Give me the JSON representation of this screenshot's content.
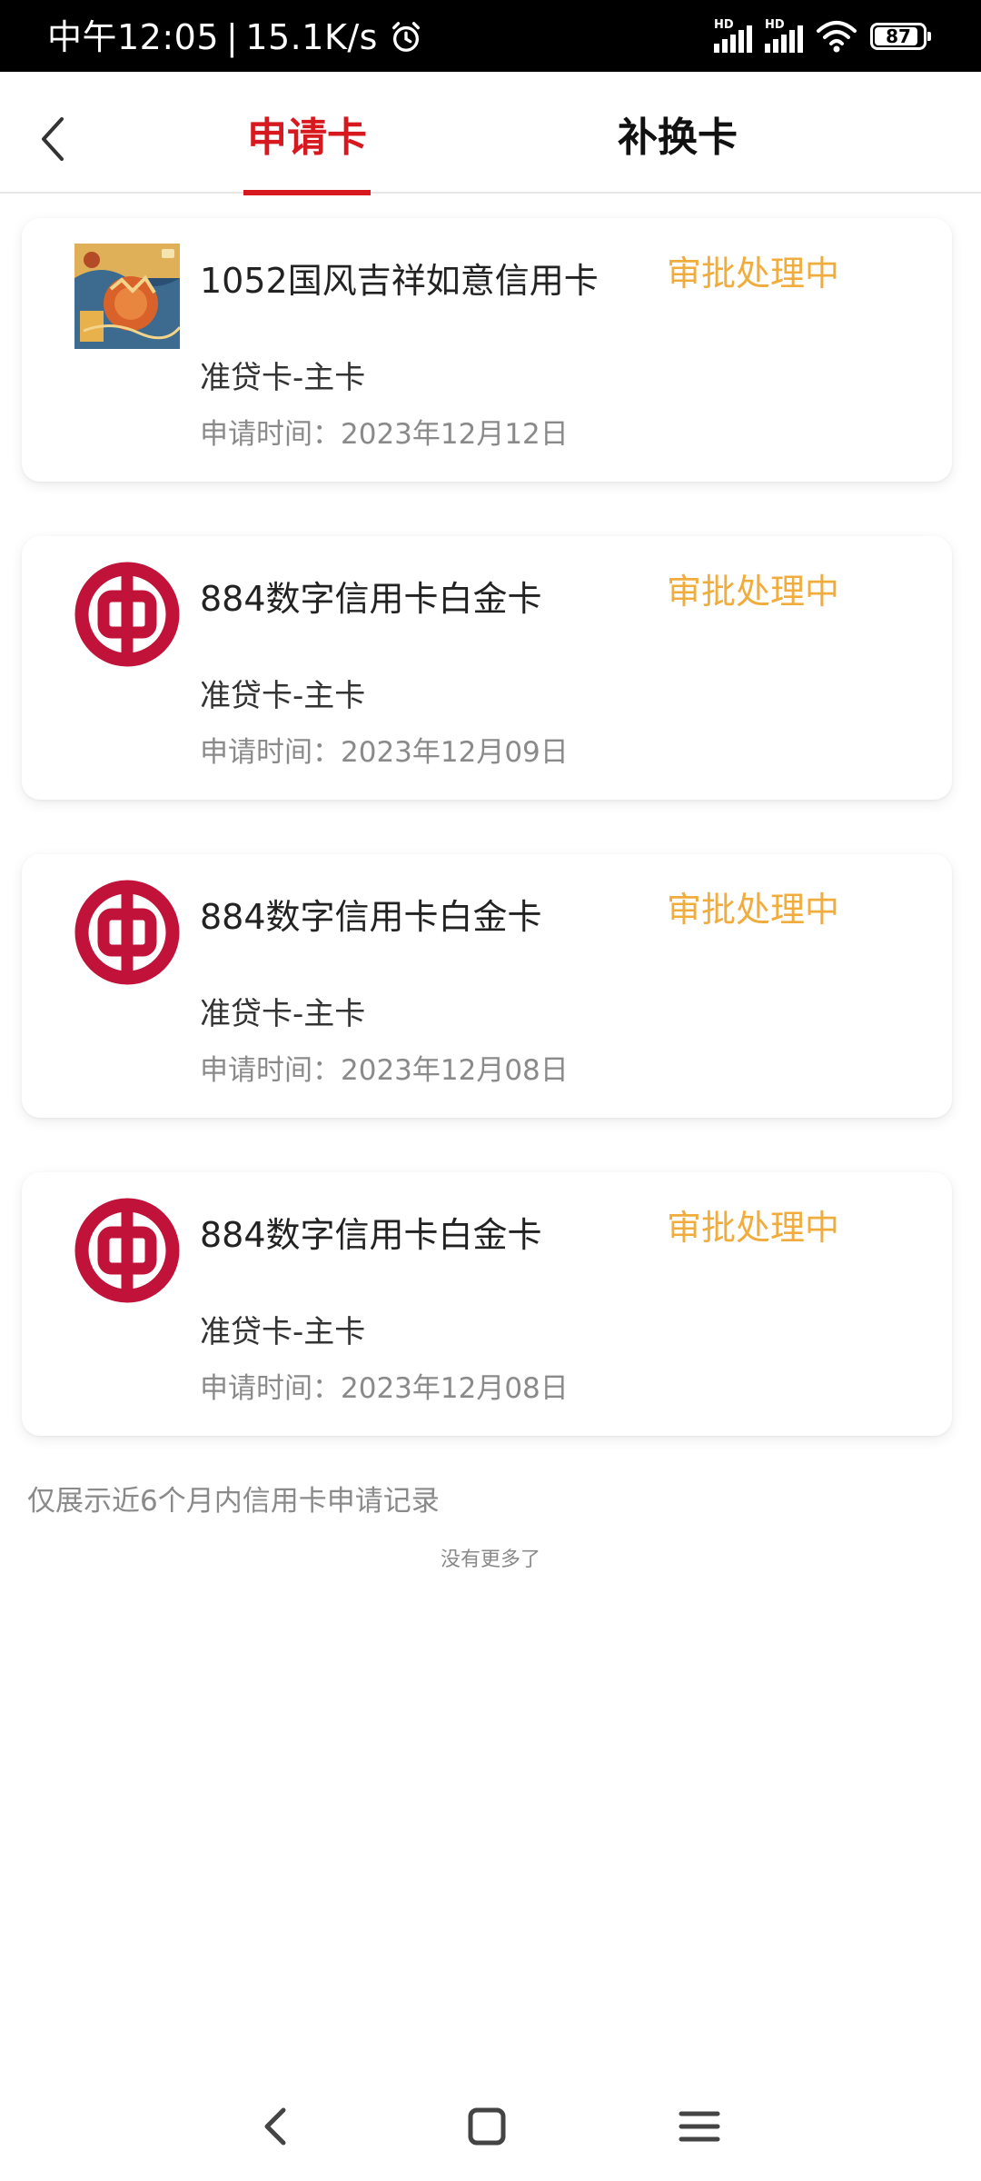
{
  "status_bar": {
    "time": "中午12:05",
    "speed": "15.1K/s",
    "network_label": "HD",
    "battery": "87"
  },
  "tabs": [
    {
      "label": "申请卡",
      "active": true
    },
    {
      "label": "补换卡",
      "active": false
    }
  ],
  "colors": {
    "accent": "#d7191f",
    "status": "#f0ac3c",
    "boc_logo": "#c1123a"
  },
  "cards": [
    {
      "name": "1052国风吉祥如意信用卡",
      "status": "审批处理中",
      "type": "准贷卡-主卡",
      "date": "申请时间：2023年12月12日",
      "icon": "guofeng-card-image"
    },
    {
      "name": "884数字信用卡白金卡",
      "status": "审批处理中",
      "type": "准贷卡-主卡",
      "date": "申请时间：2023年12月09日",
      "icon": "bank-of-china-logo"
    },
    {
      "name": "884数字信用卡白金卡",
      "status": "审批处理中",
      "type": "准贷卡-主卡",
      "date": "申请时间：2023年12月08日",
      "icon": "bank-of-china-logo"
    },
    {
      "name": "884数字信用卡白金卡",
      "status": "审批处理中",
      "type": "准贷卡-主卡",
      "date": "申请时间：2023年12月08日",
      "icon": "bank-of-china-logo"
    }
  ],
  "footnote": "仅展示近6个月内信用卡申请记录",
  "no_more": "没有更多了"
}
